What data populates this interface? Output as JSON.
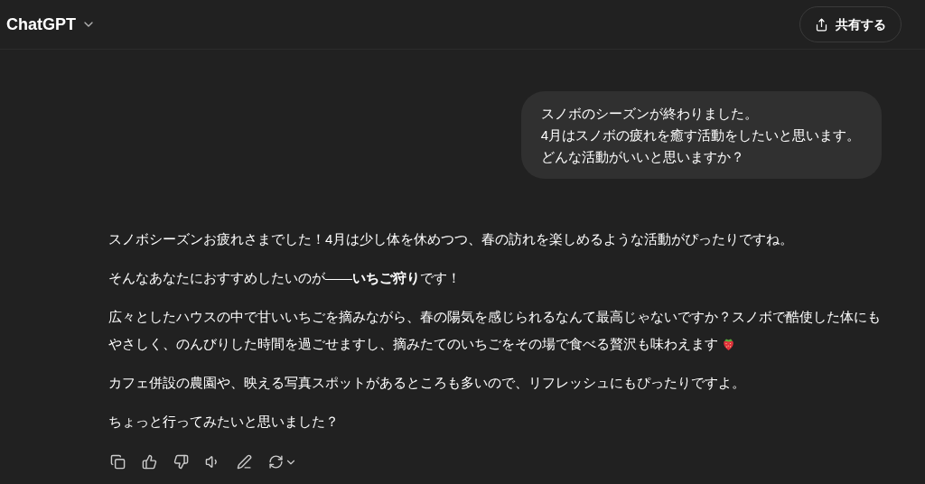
{
  "header": {
    "title": "ChatGPT",
    "share_button": "共有する"
  },
  "user_message": {
    "lines": [
      "スノボのシーズンが終わりました。",
      "4月はスノボの疲れを癒す活動をしたいと思います。",
      "どんな活動がいいと思いますか？"
    ]
  },
  "assistant_message": {
    "paragraphs": [
      {
        "lines": [
          "スノボシーズンお疲れさまでした！4月は少し体を休めつつ、春の訪れを楽しめるような活動がぴったりですね。"
        ]
      },
      {
        "lines": [
          "そんなあなたにおすすめしたいのが——**いちご狩り**です！"
        ]
      },
      {
        "lines": [
          "広々としたハウスの中で甘いいちごを摘みながら、春の陽気を感じられるなんて最高じゃないですか？スノボで酷使した体にも",
          "やさしく、のんびりした時間を過ごせますし、摘みたてのいちごをその場で食べる贅沢も味わえます"
        ],
        "strawberry": true
      },
      {
        "lines": [
          "カフェ併設の農園や、映える写真スポットがあるところも多いので、リフレッシュにもぴったりですよ。"
        ]
      },
      {
        "lines": [
          "ちょっと行ってみたいと思いました？"
        ]
      }
    ]
  }
}
